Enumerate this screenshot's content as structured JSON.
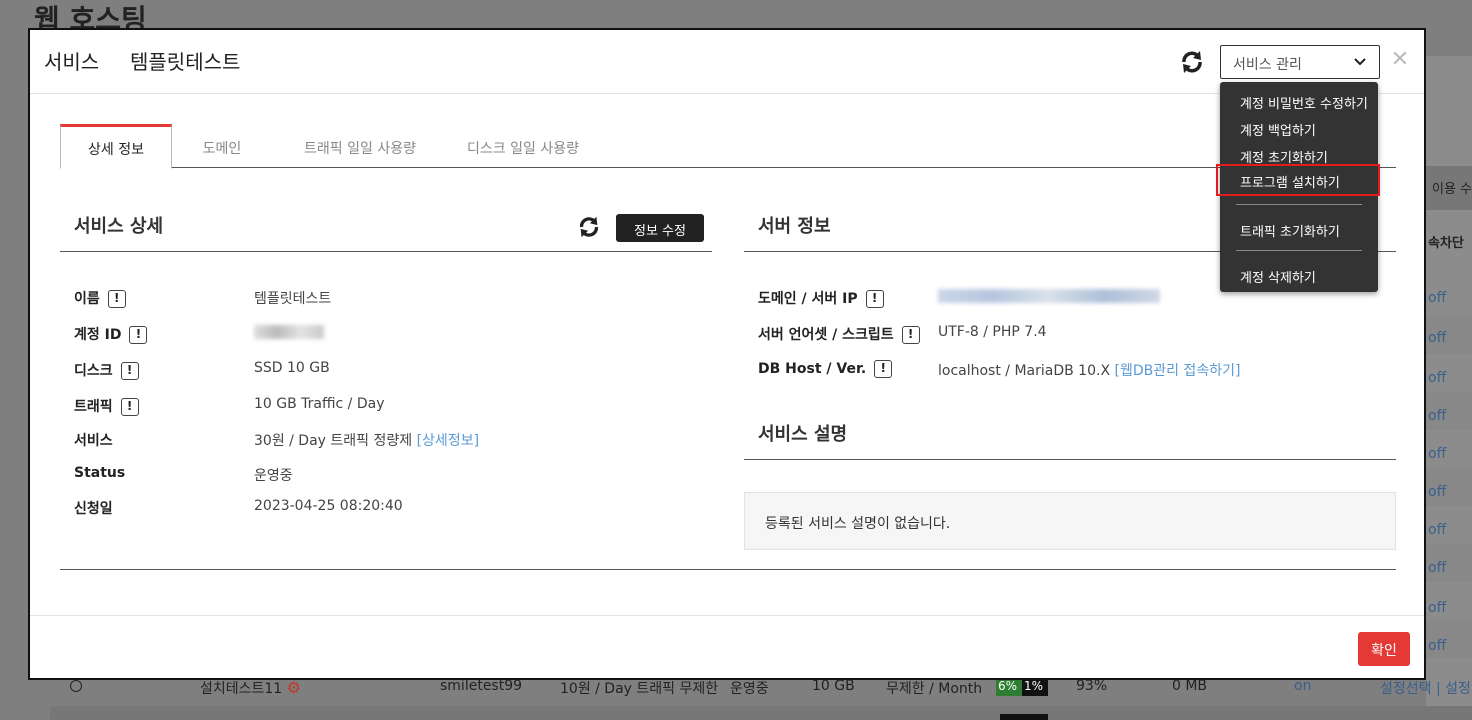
{
  "background": {
    "page_title": "웹 호스팅",
    "right_header": "이용 수",
    "right_subheader": "속차단",
    "off_labels": [
      "off",
      "off",
      "off",
      "off",
      "off",
      "off",
      "off",
      "off",
      "off",
      "off"
    ],
    "row": {
      "name": "설치테스트11",
      "account": "smiletest99",
      "plan": "10원 / Day 트래픽 무제한",
      "status": "운영중",
      "disk": "10 GB",
      "traffic": "무제한 / Month",
      "usage_a": "6%",
      "usage_b": "1%",
      "percent": "93%",
      "size": "0 MB",
      "on": "on",
      "actions": "설정선택 | 설정변"
    }
  },
  "modal": {
    "title": "서비스",
    "service_name": "템플릿테스트",
    "select_value": "서비스 관리",
    "close_glyph": "✕",
    "tabs": [
      {
        "label": "상세 정보",
        "active": true
      },
      {
        "label": "도메인",
        "active": false
      },
      {
        "label": "트래픽 일일 사용량",
        "active": false
      },
      {
        "label": "디스크 일일 사용량",
        "active": false
      }
    ],
    "service_detail": {
      "title": "서비스 상세",
      "edit_label": "정보 수정",
      "rows": {
        "name": {
          "label": "이름",
          "value": "템플릿테스트"
        },
        "account": {
          "label": "계정 ID"
        },
        "disk": {
          "label": "디스크",
          "value": "SSD 10 GB"
        },
        "traffic": {
          "label": "트래픽",
          "value": "10 GB Traffic / Day"
        },
        "service": {
          "label": "서비스",
          "value": "30원 / Day 트래픽 정량제",
          "link": "[상세정보]"
        },
        "status": {
          "label": "Status",
          "value": "운영중"
        },
        "date": {
          "label": "신청일",
          "value": "2023-04-25 08:20:40"
        }
      }
    },
    "server_info": {
      "title": "서버 정보",
      "rows": {
        "domain": {
          "label": "도메인 / 서버 IP"
        },
        "charset": {
          "label": "서버 언어셋 / 스크립트",
          "value": "UTF-8 / PHP 7.4"
        },
        "db": {
          "label": "DB Host / Ver.",
          "value": "localhost / MariaDB 10.X",
          "link": "[웹DB관리 접속하기]"
        }
      }
    },
    "service_desc": {
      "title": "서비스 설명",
      "text": "등록된 서비스 설명이 없습니다."
    },
    "confirm_label": "확인"
  },
  "dropdown": {
    "items": [
      "계정 비밀번호 수정하기",
      "계정 백업하기",
      "계정 초기화하기",
      "프로그램 설치하기",
      "트래픽 초기화하기",
      "계정 삭제하기"
    ],
    "highlighted_index": 3
  },
  "colors": {
    "accent": "#e53935",
    "link": "#5b9bd5",
    "dropdown_bg": "#333333",
    "highlight_border": "#e01c1c"
  }
}
